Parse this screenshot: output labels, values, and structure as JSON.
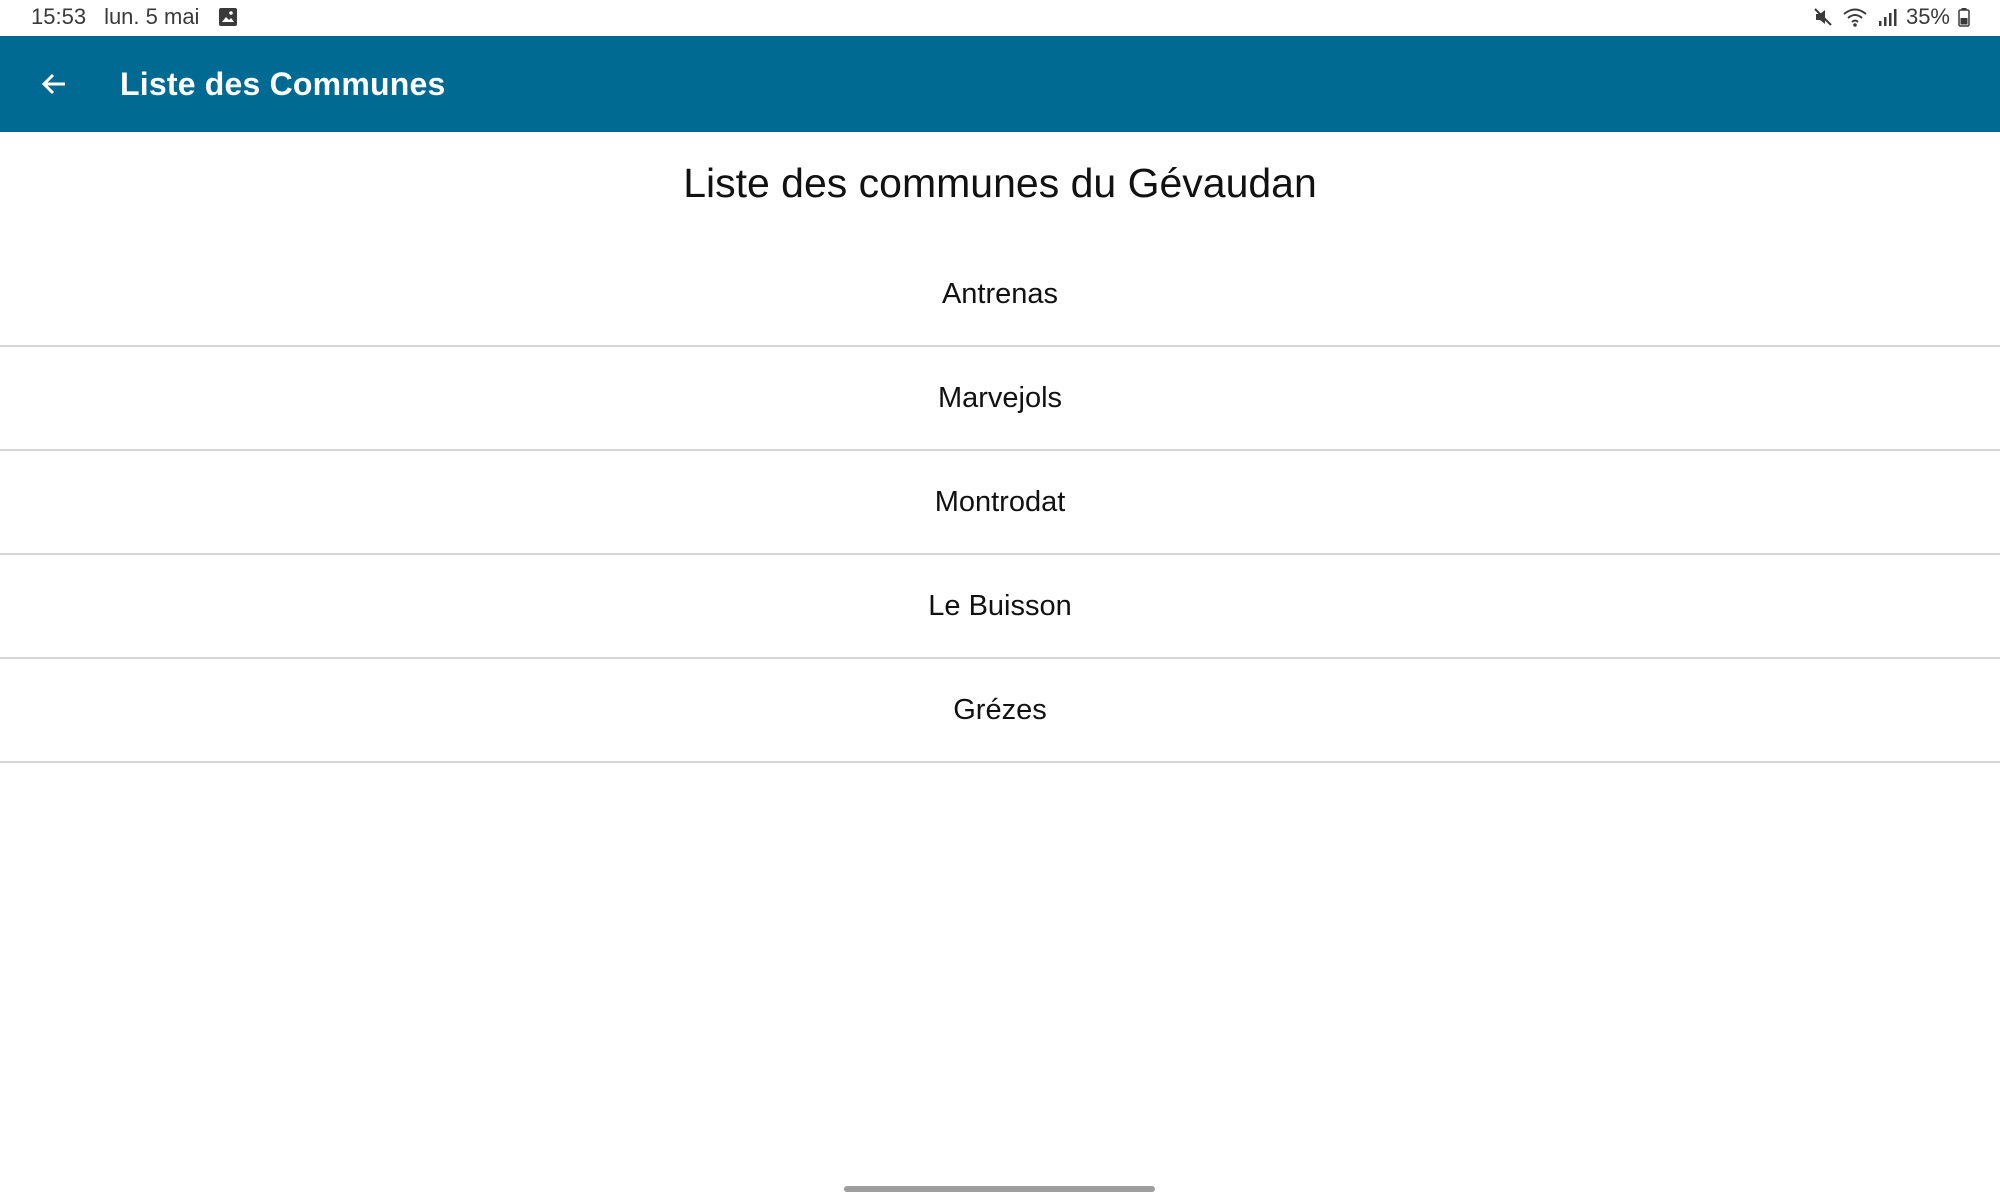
{
  "status_bar": {
    "time": "15:53",
    "date": "lun. 5 mai",
    "battery_percent": "35%",
    "left_icons": [
      "gallery-notification-icon"
    ],
    "right_icons": [
      "mute-icon",
      "wifi-icon",
      "signal-icon",
      "battery-icon"
    ]
  },
  "app_bar": {
    "title": "Liste des Communes",
    "back_icon": "arrow-left-icon",
    "background_color": "#006A93"
  },
  "main": {
    "heading": "Liste des communes du Gévaudan",
    "communes": [
      {
        "name": "Antrenas"
      },
      {
        "name": "Marvejols"
      },
      {
        "name": "Montrodat"
      },
      {
        "name": "Le Buisson"
      },
      {
        "name": "Grézes"
      }
    ]
  },
  "colors": {
    "accent": "#006A93",
    "divider": "#D6D6D6",
    "text": "#111111"
  }
}
